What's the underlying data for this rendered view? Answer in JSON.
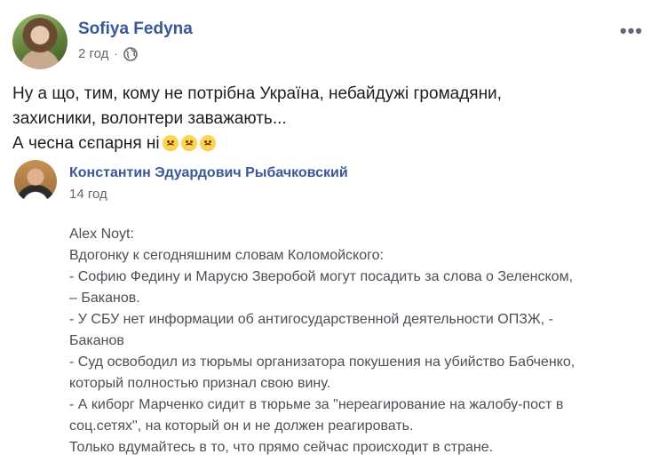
{
  "post": {
    "author": "Sofiya Fedyna",
    "time": "2 год",
    "more": "•••",
    "lines": [
      "Ну а що, тим, кому не потрібна Україна, небайдужі громадяни,",
      "захисники, волонтери заважають...",
      "А чесна сєпарня ні"
    ],
    "emojis": [
      "frowning-face",
      "frowning-face",
      "frowning-face"
    ]
  },
  "shared": {
    "author": "Константин Эдуардович Рыбачковский",
    "time": "14 год",
    "lines": [
      "Alex Noyt:",
      "Вдогонку к сегодняшним словам Коломойского:",
      "- Софию Федину и Марусю Зверобой могут посадить за слова о Зеленском,",
      "– Баканов.",
      "- У СБУ нет информации об антигосударственной деятельности ОПЗЖ, -",
      "Баканов",
      "- Суд освободил из тюрьмы организатора покушения на убийство Бабченко,",
      "который полностью признал свою вину.",
      "- А киборг Марченко сидит в тюрьме за \"нереагирование на жалобу-пост в",
      "соц.сетях\", на который он и не должен реагировать.",
      "Только вдумайтесь в то, что прямо сейчас происходит в стране."
    ]
  },
  "colors": {
    "link": "#385898",
    "meta": "#606770",
    "text": "#1c1e21",
    "shared_text": "#4b4f56"
  }
}
